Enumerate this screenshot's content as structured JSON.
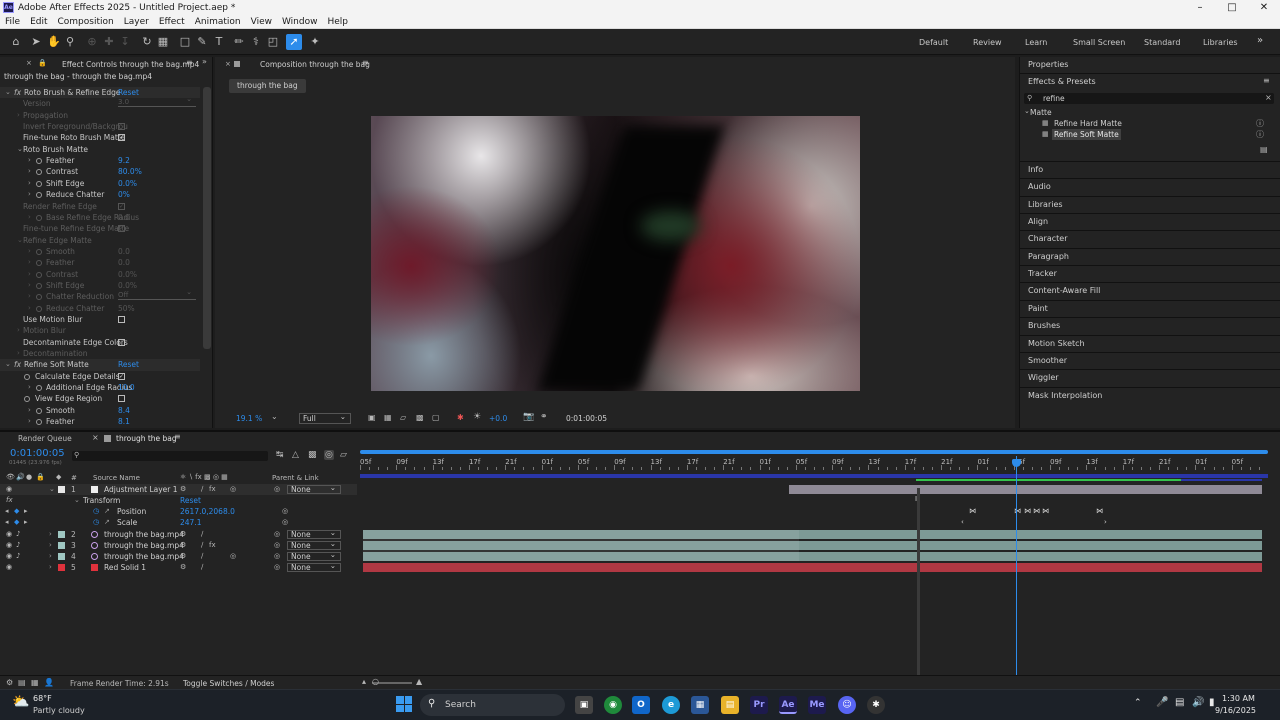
{
  "window": {
    "title": "Adobe After Effects 2025 - Untitled Project.aep *",
    "logo_text": "Ae"
  },
  "menu": [
    "File",
    "Edit",
    "Composition",
    "Layer",
    "Effect",
    "Animation",
    "View",
    "Window",
    "Help"
  ],
  "workspaces": [
    "Default",
    "Review",
    "Learn",
    "Small Screen",
    "Standard",
    "Libraries"
  ],
  "effect_controls": {
    "tab_label": "Effect Controls through the bag.mp4",
    "layer_path": "through the bag - through the bag.mp4",
    "reset_label": "Reset",
    "rows": [
      {
        "label": "Roto Brush & Refine Edge",
        "kind": "effect",
        "value": "Reset"
      },
      {
        "label": "Version",
        "kind": "dropdown",
        "value": "3.0",
        "disabled": true
      },
      {
        "label": "Propagation",
        "kind": "group",
        "disabled": true
      },
      {
        "label": "Invert Foreground/Backgrou",
        "kind": "check",
        "disabled": true
      },
      {
        "label": "Fine-tune Roto Brush Matte",
        "kind": "check",
        "checked": true
      },
      {
        "label": "Roto Brush Matte",
        "kind": "group-open"
      },
      {
        "label": "Feather",
        "kind": "prop",
        "value": "9.2"
      },
      {
        "label": "Contrast",
        "kind": "prop",
        "value": "80.0%"
      },
      {
        "label": "Shift Edge",
        "kind": "prop",
        "value": "0.0%"
      },
      {
        "label": "Reduce Chatter",
        "kind": "prop",
        "value": "0%"
      },
      {
        "label": "Render Refine Edge",
        "kind": "check",
        "disabled": true,
        "checked": true
      },
      {
        "label": "Base Refine Edge Radius",
        "kind": "prop",
        "value": "0.0",
        "disabled": true
      },
      {
        "label": "Fine-tune Refine Edge Matte",
        "kind": "check",
        "disabled": true,
        "checked": true
      },
      {
        "label": "Refine Edge Matte",
        "kind": "group-open",
        "disabled": true
      },
      {
        "label": "Smooth",
        "kind": "prop",
        "value": "0.0",
        "disabled": true
      },
      {
        "label": "Feather",
        "kind": "prop",
        "value": "0.0",
        "disabled": true
      },
      {
        "label": "Contrast",
        "kind": "prop",
        "value": "0.0%",
        "disabled": true
      },
      {
        "label": "Shift Edge",
        "kind": "prop",
        "value": "0.0%",
        "disabled": true
      },
      {
        "label": "Chatter Reduction",
        "kind": "dropdown-prop",
        "value": "Off",
        "disabled": true
      },
      {
        "label": "Reduce Chatter",
        "kind": "prop",
        "value": "50%",
        "disabled": true
      },
      {
        "label": "Use Motion Blur",
        "kind": "check"
      },
      {
        "label": "Motion Blur",
        "kind": "group",
        "disabled": true
      },
      {
        "label": "Decontaminate Edge Colors",
        "kind": "check"
      },
      {
        "label": "Decontamination",
        "kind": "group",
        "disabled": true
      },
      {
        "label": "Refine Soft Matte",
        "kind": "effect",
        "value": "Reset"
      },
      {
        "label": "Calculate Edge Details",
        "kind": "check-sw",
        "checked": true
      },
      {
        "label": "Additional Edge Radius",
        "kind": "prop",
        "value": "10.0"
      },
      {
        "label": "View Edge Region",
        "kind": "check-sw"
      },
      {
        "label": "Smooth",
        "kind": "prop",
        "value": "8.4"
      },
      {
        "label": "Feather",
        "kind": "prop",
        "value": "8.1"
      }
    ]
  },
  "composition": {
    "tab_label": "Composition through the bag",
    "breadcrumb": "through the bag",
    "zoom": "19.1",
    "zoom_unit": "%",
    "resolution": "Full",
    "exposure": "+0.0",
    "timecode": "0:01:00:05"
  },
  "right_panel": {
    "properties_label": "Properties",
    "effects_presets_label": "Effects & Presets",
    "search_value": "refine",
    "category": "Matte",
    "presets": [
      "Refine Hard Matte",
      "Refine Soft Matte"
    ],
    "selected_index": 1,
    "sections": [
      "Info",
      "Audio",
      "Libraries",
      "Align",
      "Character",
      "Paragraph",
      "Tracker",
      "Content-Aware Fill",
      "Paint",
      "Brushes",
      "Motion Sketch",
      "Smoother",
      "Wiggler",
      "Mask Interpolation"
    ]
  },
  "timeline": {
    "tabs": [
      "Render Queue",
      "through the bag"
    ],
    "timecode": "0:01:00:05",
    "frame_info": "01445 (23.976 fps)",
    "col_number": "#",
    "col_source": "Source Name",
    "col_parent": "Parent & Link",
    "ruler": [
      "05f",
      "09f",
      "13f",
      "17f",
      "21f",
      "01f",
      "05f",
      "09f",
      "13f",
      "17f",
      "21f",
      "01f",
      "05f",
      "09f",
      "13f",
      "17f",
      "21f",
      "01f",
      "05f",
      "09f",
      "13f",
      "17f",
      "21f",
      "01f",
      "05f"
    ],
    "transform_label": "Transform",
    "transform_reset": "Reset",
    "position_label": "Position",
    "position_value": "2617.0,2068.0",
    "scale_label": "Scale",
    "scale_value": "247.1",
    "parent_none": "None",
    "layers": [
      {
        "num": "1",
        "name": "Adjustment Layer 1",
        "color": "#e8e8e8"
      },
      {
        "num": "2",
        "name": "through the bag.mp4",
        "color": "#9fc7c2"
      },
      {
        "num": "3",
        "name": "through the bag.mp4",
        "color": "#9fc7c2"
      },
      {
        "num": "4",
        "name": "through the bag.mp4",
        "color": "#9fc7c2"
      },
      {
        "num": "5",
        "name": "Red Solid 1",
        "color": "#e0323c"
      }
    ],
    "footer_render": "Frame Render Time: 2.91s",
    "footer_toggle": "Toggle Switches / Modes"
  },
  "taskbar": {
    "weather_temp": "68°F",
    "weather_desc": "Partly cloudy",
    "search_label": "Search",
    "time": "1:30 AM",
    "date": "9/16/2025"
  }
}
